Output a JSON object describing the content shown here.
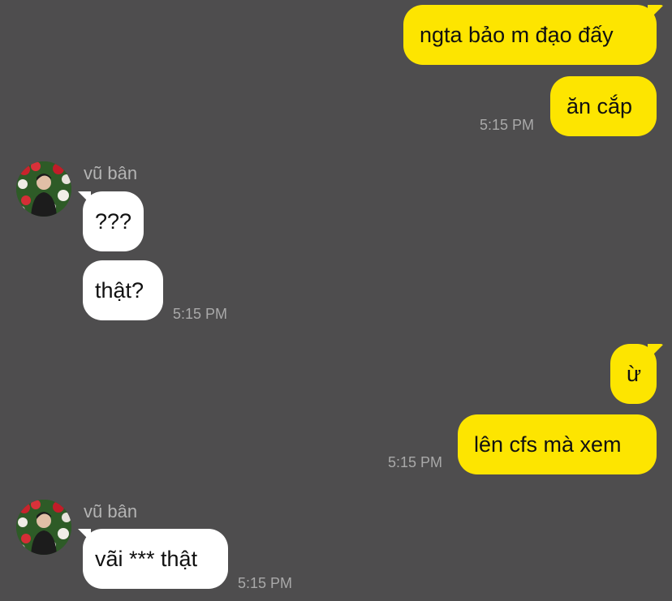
{
  "colors": {
    "background": "#4e4d4e",
    "outgoing_bubble": "#fde500",
    "incoming_bubble": "#ffffff",
    "timestamp": "#a9a9a9",
    "sender_name": "#b4b4b4"
  },
  "messages": {
    "out1": {
      "text": "ngta bảo m đạo đấy"
    },
    "out2": {
      "text": "ăn cắp",
      "time": "5:15 PM"
    },
    "in_group1": {
      "sender": "vũ bân",
      "avatar_icon": "profile-photo-avatar",
      "msg1": {
        "text": "???"
      },
      "msg2": {
        "text": "thật?",
        "time": "5:15 PM"
      }
    },
    "out3": {
      "text": "ừ"
    },
    "out4": {
      "text": "lên cfs mà xem",
      "time": "5:15 PM"
    },
    "in_group2": {
      "sender": "vũ bân",
      "avatar_icon": "profile-photo-avatar",
      "msg1": {
        "text": "vãi *** thật",
        "time": "5:15 PM"
      }
    }
  }
}
